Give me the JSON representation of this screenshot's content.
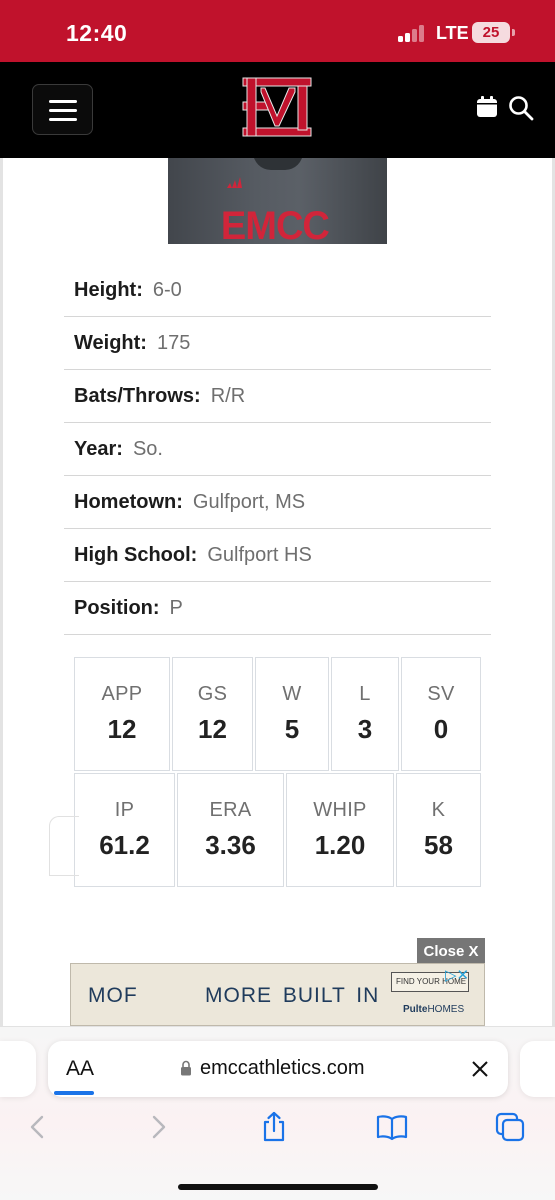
{
  "status_bar": {
    "time": "12:40",
    "network": "LTE",
    "battery": "25"
  },
  "header": {
    "logo_text": "EM",
    "icons": [
      "menu-icon",
      "calendar-icon",
      "search-icon"
    ]
  },
  "player_photo": {
    "jersey_text": "EMCC"
  },
  "bio": [
    {
      "label": "Height:",
      "value": "6-0"
    },
    {
      "label": "Weight:",
      "value": "175"
    },
    {
      "label": "Bats/Throws:",
      "value": "R/R"
    },
    {
      "label": "Year:",
      "value": "So."
    },
    {
      "label": "Hometown:",
      "value": "Gulfport, MS"
    },
    {
      "label": "High School:",
      "value": "Gulfport HS"
    },
    {
      "label": "Position:",
      "value": "P"
    }
  ],
  "stats": {
    "row1": [
      {
        "label": "APP",
        "value": "12"
      },
      {
        "label": "GS",
        "value": "12"
      },
      {
        "label": "W",
        "value": "5"
      },
      {
        "label": "L",
        "value": "3"
      },
      {
        "label": "SV",
        "value": "0"
      }
    ],
    "row2": [
      {
        "label": "IP",
        "value": "61.2"
      },
      {
        "label": "ERA",
        "value": "3.36"
      },
      {
        "label": "WHIP",
        "value": "1.20"
      },
      {
        "label": "K",
        "value": "58"
      }
    ]
  },
  "ad": {
    "close_label": "Close X",
    "text_left": "MOF",
    "text_main": "MORE BUILT IN",
    "find_label": "FIND YOUR HOME",
    "brand": "Pulte",
    "brand_suffix": "HOMES"
  },
  "browser": {
    "aa_label": "AA",
    "url": "emccathletics.com",
    "toolbar_icons": [
      "back-icon",
      "forward-icon",
      "share-icon",
      "bookmarks-icon",
      "tabs-icon"
    ]
  },
  "colors": {
    "brand_red": "#c0122c",
    "header_black": "#000000",
    "ios_blue": "#1a73e8"
  }
}
